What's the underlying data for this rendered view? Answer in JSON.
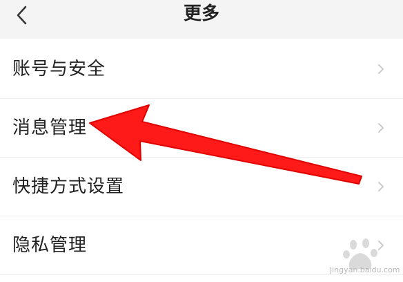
{
  "header": {
    "title": "更多",
    "back_icon": "chevron-left-icon"
  },
  "settings": {
    "items": [
      {
        "label": "账号与安全",
        "icon": "chevron-right-icon"
      },
      {
        "label": "消息管理",
        "icon": "chevron-right-icon"
      },
      {
        "label": "快捷方式设置",
        "icon": "chevron-right-icon"
      },
      {
        "label": "隐私管理",
        "icon": "chevron-right-icon"
      }
    ]
  },
  "annotation": {
    "icon": "red-arrow-icon",
    "color": "#ff1a1a"
  },
  "watermark": {
    "text": "jingyan.baidu.com"
  },
  "colors": {
    "header_bg": "#f4f4f4",
    "text": "#222222",
    "chevron": "#cccccc",
    "divider": "#eeeeee"
  }
}
